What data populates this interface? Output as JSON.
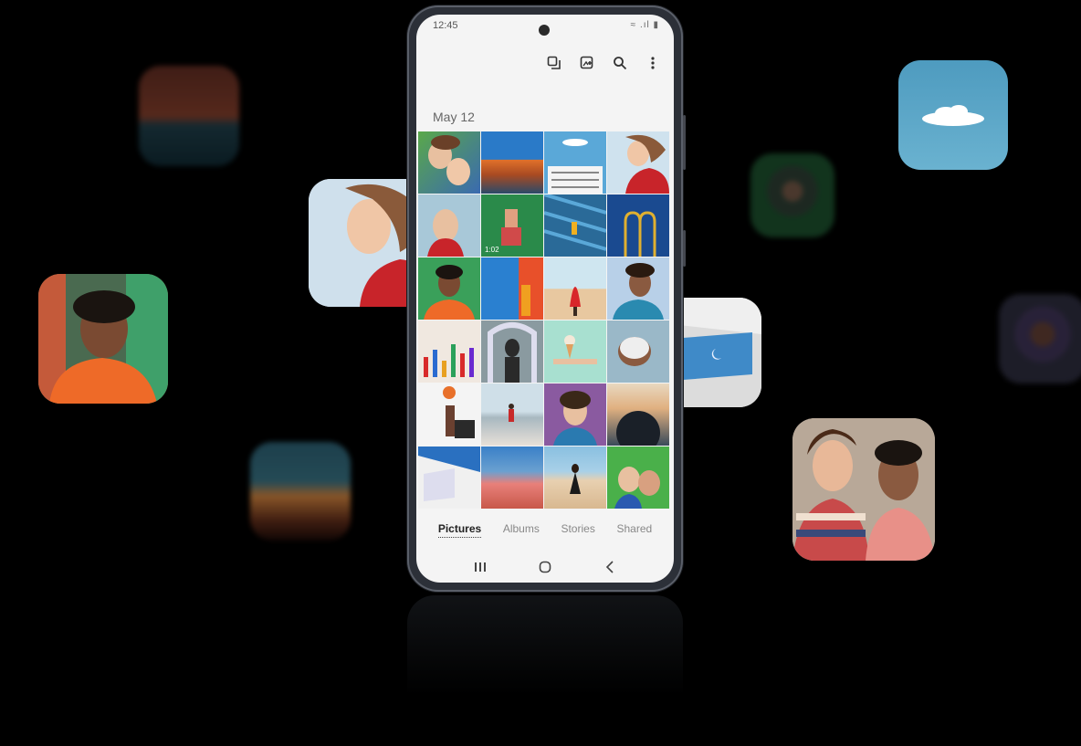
{
  "status": {
    "time": "12:45",
    "icons": "≈ .ıl ▮"
  },
  "toolbar": {
    "icons": [
      "multiselect-icon",
      "create-icon",
      "search-icon",
      "more-icon"
    ]
  },
  "date_header": "May 12",
  "video": {
    "duration": "1:02"
  },
  "tabs": [
    {
      "label": "Pictures",
      "active": true
    },
    {
      "label": "Albums",
      "active": false
    },
    {
      "label": "Stories",
      "active": false
    },
    {
      "label": "Shared",
      "active": false
    }
  ],
  "navbar": {
    "icons": [
      "recent-apps-icon",
      "home-icon",
      "back-icon"
    ]
  },
  "colors": {
    "accent": "#222222",
    "screen_bg": "#f4f4f4",
    "background": "#000000"
  }
}
